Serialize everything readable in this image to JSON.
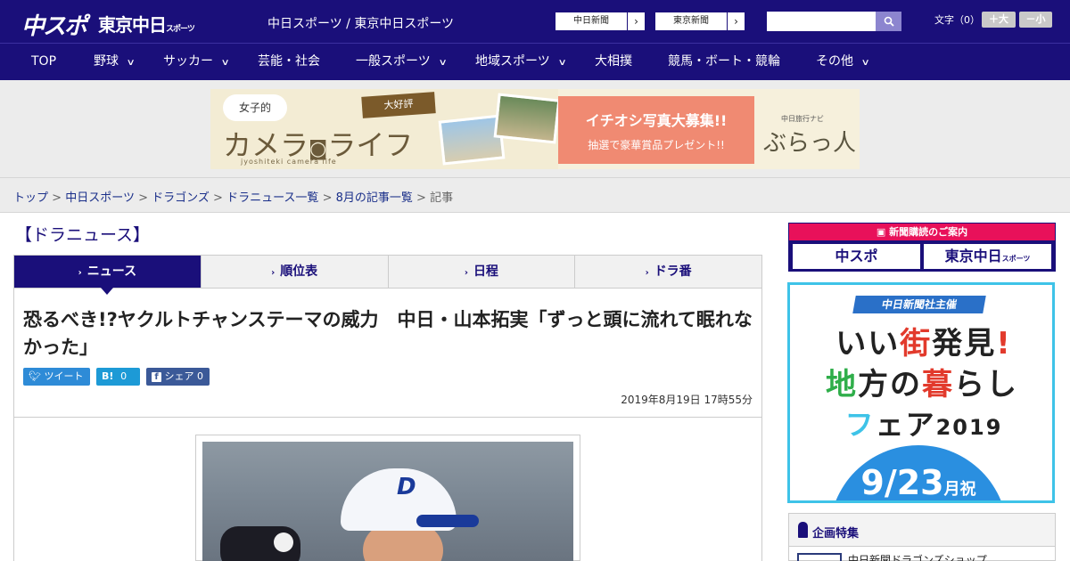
{
  "header": {
    "logo_chuspo": "中スポ",
    "logo_tokyo": "東京中日",
    "logo_tokyo_suffix": "スポーツ",
    "site_names": "中日スポーツ / 東京中日スポーツ",
    "ext_links": [
      "中日新聞",
      "東京新聞"
    ],
    "search_placeholder": "",
    "font_size_label": "文字（0）",
    "font_plus": "＋大",
    "font_minus": "－小"
  },
  "nav": {
    "items": [
      {
        "label": "TOP",
        "dropdown": false
      },
      {
        "label": "野球",
        "dropdown": true
      },
      {
        "label": "サッカー",
        "dropdown": true
      },
      {
        "label": "芸能・社会",
        "dropdown": false
      },
      {
        "label": "一般スポーツ",
        "dropdown": true
      },
      {
        "label": "地域スポーツ",
        "dropdown": true
      },
      {
        "label": "大相撲",
        "dropdown": false
      },
      {
        "label": "競馬・ボート・競輪",
        "dropdown": false
      },
      {
        "label": "その他",
        "dropdown": true
      }
    ]
  },
  "banner": {
    "bubble": "女子的",
    "title": "カメラ",
    "title2": "ライフ",
    "sub": "jyoshiteki camera life",
    "tag": "大好評",
    "headline": "イチオシ写真大募集!!",
    "subline": "抽選で豪華賞品プレゼント!!",
    "brand_small": "中日旅行ナビ",
    "brand": "ぶらっ人"
  },
  "breadcrumb": {
    "links": [
      "トップ",
      "中日スポーツ",
      "ドラゴンズ",
      "ドラニュース一覧",
      "8月の記事一覧"
    ],
    "current": "記事",
    "separator": ">"
  },
  "section": {
    "title": "【ドラニュース】"
  },
  "tabs": [
    {
      "label": "ニュース",
      "active": true
    },
    {
      "label": "順位表",
      "active": false
    },
    {
      "label": "日程",
      "active": false
    },
    {
      "label": "ドラ番",
      "active": false
    }
  ],
  "article": {
    "headline": "恐るべき!?ヤクルトチャンステーマの威力　中日・山本拓実「ずっと頭に流れて眠れなかった」",
    "share": {
      "tweet": "ツイート",
      "hatena": "B!",
      "hatena_count": "0",
      "fb": "シェア",
      "fb_count": "0"
    },
    "date": "2019年8月19日 17時55分",
    "photo_cap_letter": "D"
  },
  "sidebar": {
    "subscribe_title": "新聞購読のご案内",
    "sub_brand1": "中スポ",
    "sub_brand2": "東京中日",
    "sub_brand2_suffix": "スポーツ",
    "fair_pill": "中日新聞社主催",
    "fair_line1a": "いい",
    "fair_line1b": "街",
    "fair_line1c": "発見",
    "fair_line1d": "!",
    "fair_line2a": "地",
    "fair_line2b": "方の",
    "fair_line2c": "暮",
    "fair_line2d": "らし",
    "fair_line3a": "フ",
    "fair_line3b": "ェア",
    "fair_line3c": "2019",
    "fair_date": "9/23",
    "fair_date_suffix": "月祝",
    "feature_title": "企画特集",
    "feature_item": "中日新聞ドラゴンズショップ"
  },
  "colors": {
    "brand_navy": "#1a0f7a",
    "accent_pink": "#e8115a",
    "fair_cyan": "#3ec3e8"
  }
}
